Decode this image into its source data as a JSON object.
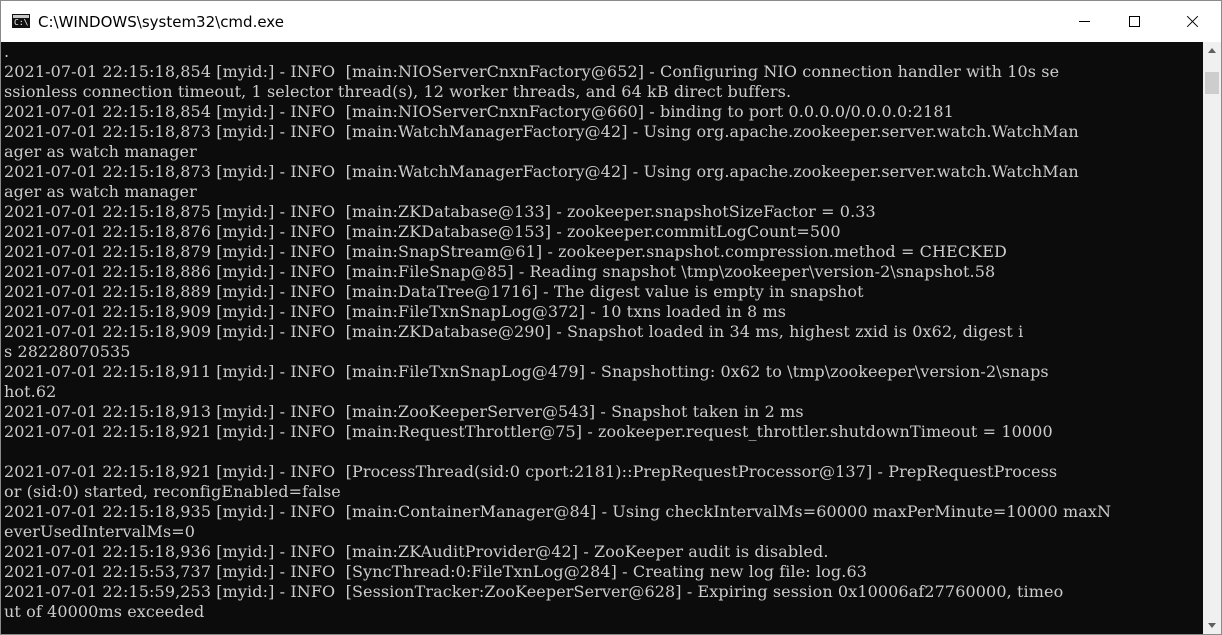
{
  "window": {
    "title": "C:\\WINDOWS\\system32\\cmd.exe",
    "icon": "command-prompt-icon",
    "icon_glyph": "C:\\"
  },
  "controls": {
    "minimize": "minimize-icon",
    "maximize": "maximize-icon",
    "close": "close-icon"
  },
  "console": {
    "lines": [
      ".",
      "2021-07-01 22:15:18,854 [myid:] - INFO  [main:NIOServerCnxnFactory@652] - Configuring NIO connection handler with 10s se",
      "ssionless connection timeout, 1 selector thread(s), 12 worker threads, and 64 kB direct buffers.",
      "2021-07-01 22:15:18,854 [myid:] - INFO  [main:NIOServerCnxnFactory@660] - binding to port 0.0.0.0/0.0.0.0:2181",
      "2021-07-01 22:15:18,873 [myid:] - INFO  [main:WatchManagerFactory@42] - Using org.apache.zookeeper.server.watch.WatchMan",
      "ager as watch manager",
      "2021-07-01 22:15:18,873 [myid:] - INFO  [main:WatchManagerFactory@42] - Using org.apache.zookeeper.server.watch.WatchMan",
      "ager as watch manager",
      "2021-07-01 22:15:18,875 [myid:] - INFO  [main:ZKDatabase@133] - zookeeper.snapshotSizeFactor = 0.33",
      "2021-07-01 22:15:18,876 [myid:] - INFO  [main:ZKDatabase@153] - zookeeper.commitLogCount=500",
      "2021-07-01 22:15:18,879 [myid:] - INFO  [main:SnapStream@61] - zookeeper.snapshot.compression.method = CHECKED",
      "2021-07-01 22:15:18,886 [myid:] - INFO  [main:FileSnap@85] - Reading snapshot \\tmp\\zookeeper\\version-2\\snapshot.58",
      "2021-07-01 22:15:18,889 [myid:] - INFO  [main:DataTree@1716] - The digest value is empty in snapshot",
      "2021-07-01 22:15:18,909 [myid:] - INFO  [main:FileTxnSnapLog@372] - 10 txns loaded in 8 ms",
      "2021-07-01 22:15:18,909 [myid:] - INFO  [main:ZKDatabase@290] - Snapshot loaded in 34 ms, highest zxid is 0x62, digest i",
      "s 28228070535",
      "2021-07-01 22:15:18,911 [myid:] - INFO  [main:FileTxnSnapLog@479] - Snapshotting: 0x62 to \\tmp\\zookeeper\\version-2\\snaps",
      "hot.62",
      "2021-07-01 22:15:18,913 [myid:] - INFO  [main:ZooKeeperServer@543] - Snapshot taken in 2 ms",
      "2021-07-01 22:15:18,921 [myid:] - INFO  [main:RequestThrottler@75] - zookeeper.request_throttler.shutdownTimeout = 10000",
      "",
      "2021-07-01 22:15:18,921 [myid:] - INFO  [ProcessThread(sid:0 cport:2181)::PrepRequestProcessor@137] - PrepRequestProcess",
      "or (sid:0) started, reconfigEnabled=false",
      "2021-07-01 22:15:18,935 [myid:] - INFO  [main:ContainerManager@84] - Using checkIntervalMs=60000 maxPerMinute=10000 maxN",
      "everUsedIntervalMs=0",
      "2021-07-01 22:15:18,936 [myid:] - INFO  [main:ZKAuditProvider@42] - ZooKeeper audit is disabled.",
      "2021-07-01 22:15:53,737 [myid:] - INFO  [SyncThread:0:FileTxnLog@284] - Creating new log file: log.63",
      "2021-07-01 22:15:59,253 [myid:] - INFO  [SessionTracker:ZooKeeperServer@628] - Expiring session 0x10006af27760000, timeo",
      "ut of 40000ms exceeded"
    ]
  },
  "scrollbar": {
    "up": "scroll-up-arrow-icon",
    "down": "scroll-down-arrow-icon"
  }
}
